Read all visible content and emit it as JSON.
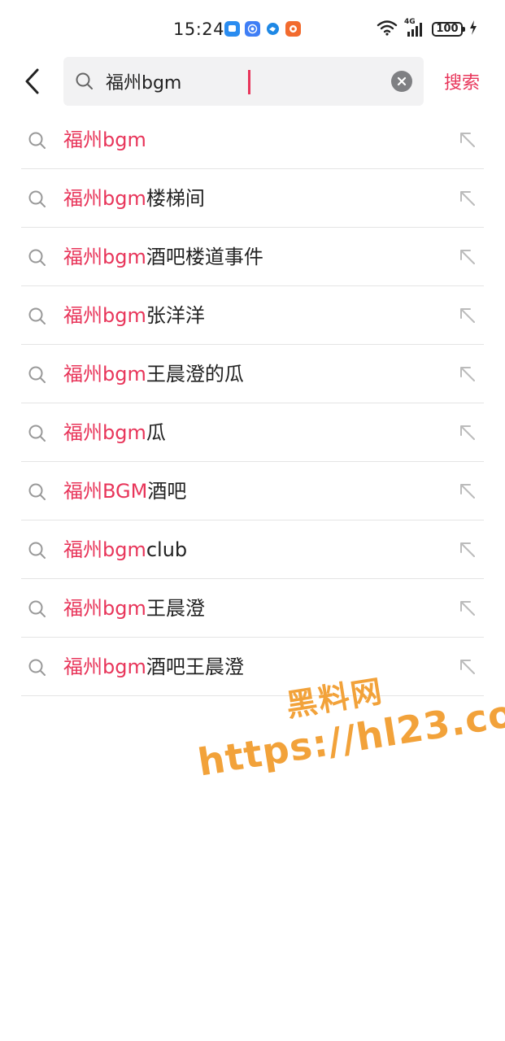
{
  "status_bar": {
    "time": "15:24",
    "network": "4G",
    "battery": "100",
    "notification_icons": [
      "message-app-icon",
      "wireless-app-icon",
      "browser-app-icon",
      "gallery-app-icon"
    ],
    "icons": [
      "wifi-icon",
      "cellular-signal-icon",
      "battery-icon",
      "charging-icon"
    ]
  },
  "search": {
    "query": "福州bgm",
    "submit_label": "搜索",
    "accent_color": "#e8355a"
  },
  "suggestions": [
    {
      "highlight": "福州bgm",
      "rest": ""
    },
    {
      "highlight": "福州bgm",
      "rest": "楼梯间"
    },
    {
      "highlight": "福州bgm",
      "rest": "酒吧楼道事件"
    },
    {
      "highlight": "福州bgm",
      "rest": "张洋洋"
    },
    {
      "highlight": "福州bgm",
      "rest": "王晨澄的瓜"
    },
    {
      "highlight": "福州bgm",
      "rest": "瓜"
    },
    {
      "highlight": "福州BGM",
      "rest": "酒吧"
    },
    {
      "highlight": "福州bgm",
      "rest": "club"
    },
    {
      "highlight": "福州bgm",
      "rest": "王晨澄"
    },
    {
      "highlight": "福州bgm",
      "rest": "酒吧王晨澄"
    }
  ],
  "watermark": {
    "line1": "黑料网",
    "line2": "https://hl23.co",
    "color": "#f2a23a"
  }
}
